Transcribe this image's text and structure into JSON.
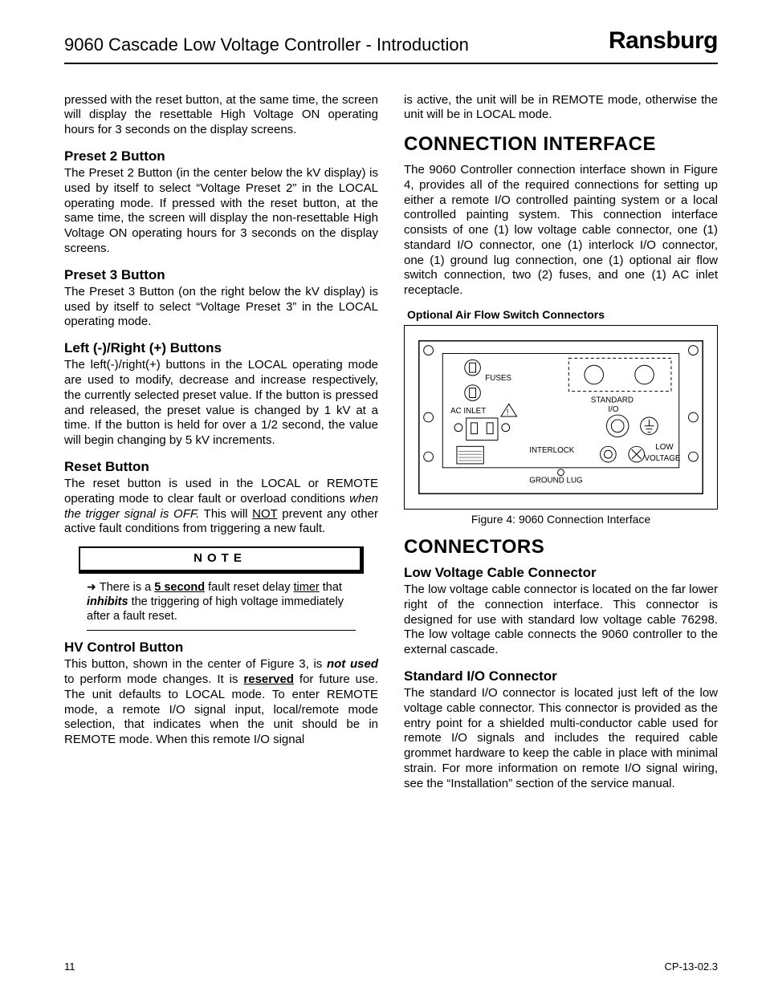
{
  "header": {
    "title": "9060 Cascade Low Voltage Controller - Introduction",
    "brand": "Ransburg"
  },
  "left": {
    "intro": "pressed with the reset button, at the same time, the screen will display the resettable High Voltage ON operating hours for 3 seconds on the display screens.",
    "preset2": {
      "title": "Preset 2 Button",
      "body": "The Preset 2 Button (in the center below the kV display) is used by itself to select “Voltage Preset 2” in the LOCAL operating mode.  If pressed with the reset button, at the same time, the screen will display the non-resettable High Voltage ON operating hours for 3 seconds on the display screens."
    },
    "preset3": {
      "title": "Preset 3 Button",
      "body": "The Preset 3 Button (on the right below the kV display) is used by itself to select “Voltage Preset 3” in the LOCAL operating mode."
    },
    "lr": {
      "title": "Left (-)/Right (+) Buttons",
      "body": "The left(-)/right(+) buttons in the LOCAL operating mode are used to modify, decrease and increase respectively, the currently selected preset value.  If the button is pressed and released, the preset value is changed by 1 kV at a time.  If the button is held for over a 1/2 second, the value will begin changing by 5 kV increments."
    },
    "reset": {
      "title": "Reset Button",
      "body_a": "The reset button is used in the LOCAL or REMOTE operating mode to clear fault or overload conditions ",
      "body_i": "when the trigger signal is OFF.",
      "body_b": "  This will ",
      "body_u": "NOT",
      "body_c": " prevent any other active fault conditions from triggering a new fault."
    },
    "note": {
      "label": "NOTE",
      "arrow": "➜",
      "a": "There is a ",
      "u": "5 second",
      "b": " fault reset delay ",
      "c": "timer",
      "d": " that ",
      "bi": "inhibits",
      "e": " the triggering of high voltage immediately after a fault reset."
    },
    "hv": {
      "title": "HV Control Button",
      "a": "This button, shown in the center of Figure 3, is ",
      "bi": "not used",
      "b": " to perform mode changes.  It is ",
      "u": "reserved",
      "c": " for future use. The unit defaults to LOCAL mode.  To enter REMOTE mode, a remote I/O signal input, local/remote mode selection, that indicates when the unit should be in REMOTE mode.  When this remote I/O signal"
    }
  },
  "right": {
    "cont": "is active, the unit will be in REMOTE mode, otherwise the unit will be in LOCAL mode.",
    "conn": {
      "title": "CONNECTION INTERFACE",
      "body": "The 9060 Controller connection interface shown in Figure 4, provides all of the required connections for setting up either a remote I/O controlled painting system or a local controlled painting system.  This connection interface consists of one (1) low voltage cable connector, one (1) standard I/O connector, one (1) interlock I/O connector, one (1) ground lug connection, one (1) optional air flow switch connection, two (2) fuses, and one (1)  AC inlet receptacle."
    },
    "fig": {
      "topcap": "Optional Air Flow Switch Connectors",
      "caption": "Figure 4:  9060 Connection Interface",
      "labels": {
        "fuses": "FUSES",
        "acinlet": "AC INLET",
        "standard": "STANDARD",
        "io": "I/O",
        "interlock": "INTERLOCK",
        "low": "LOW",
        "voltage": "VOLTAGE",
        "ground": "GROUND LUG"
      }
    },
    "connectors": {
      "title": "CONNECTORS",
      "lv": {
        "title": "Low Voltage Cable Connector",
        "body": "The low voltage cable connector is located on the far lower right of the connection interface.  This connector is designed for use with standard low voltage cable 76298.  The low voltage cable connects the 9060 controller to the external cascade."
      },
      "sio": {
        "title": "Standard I/O Connector",
        "body": "The standard I/O connector is located just left of the low voltage cable connector.  This connector is provided as the entry point for a shielded multi-conductor cable used for remote I/O signals and includes  the required cable grommet hardware to keep the cable in place with minimal strain.  For more information on remote I/O signal wiring, see the “Installation” section of the service manual."
      }
    }
  },
  "footer": {
    "page": "11",
    "doc": "CP-13-02.3"
  }
}
